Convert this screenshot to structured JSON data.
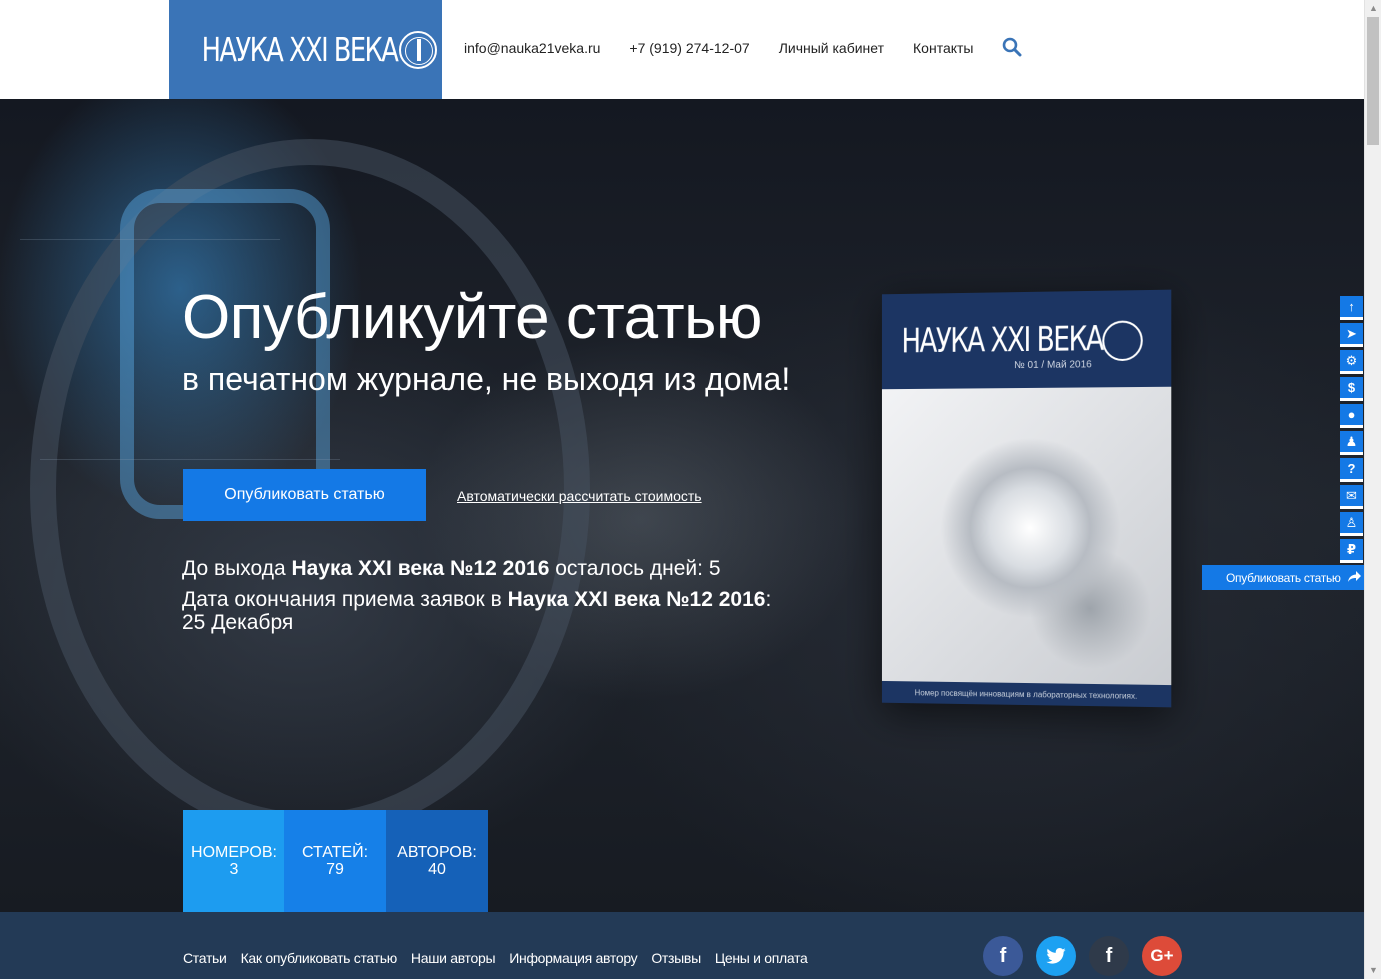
{
  "header": {
    "logo_text": "НАУКА XXI ВЕКА",
    "email": "info@nauka21veka.ru",
    "phone": "+7 (919) 274-12-07",
    "cabinet": "Личный кабинет",
    "contacts": "Контакты",
    "search_icon": "search-icon"
  },
  "hero": {
    "title": "Опубликуйте статью",
    "subtitle": "в печатном журнале, не выходя из дома!",
    "publish_button": "Опубликовать статью",
    "calc_link": "Автоматически рассчитать стоимость",
    "countdown_prefix": "До выхода ",
    "countdown_issue": "Наука XXI века №12 2016",
    "countdown_suffix": " осталось дней: 5",
    "deadline_prefix": "Дата окончания приема заявок в ",
    "deadline_issue": "Наука XXI века №12 2016",
    "deadline_suffix": ":",
    "deadline_date": "25 Декабря"
  },
  "magazine": {
    "title": "НАУКА XXI ВЕКА",
    "issue": "№ 01 / Май 2016",
    "footer": "Номер посвящён инновациям в лабораторных технологиях."
  },
  "stats": [
    {
      "label": "НОМЕРОВ:",
      "value": "3"
    },
    {
      "label": "СТАТЕЙ:",
      "value": "79"
    },
    {
      "label": "АВТОРОВ:",
      "value": "40"
    }
  ],
  "footer": {
    "links": [
      "Статьи",
      "Как опубликовать статью",
      "Наши авторы",
      "Информация автору",
      "Отзывы",
      "Цены и оплата"
    ],
    "social": [
      {
        "icon": "facebook-icon",
        "glyph": "f",
        "color": "#3b5998"
      },
      {
        "icon": "twitter-icon",
        "glyph": "t",
        "color": "#1da1f2"
      },
      {
        "icon": "facebook-icon",
        "glyph": "f",
        "color": "#2f3a4a"
      },
      {
        "icon": "google-plus-icon",
        "glyph": "G+",
        "color": "#dd4b39"
      }
    ]
  },
  "sidebar": {
    "icons": [
      {
        "icon": "arrow-up-icon",
        "glyph": "↑"
      },
      {
        "icon": "send-icon",
        "glyph": "➤"
      },
      {
        "icon": "gear-icon",
        "glyph": "⚙"
      },
      {
        "icon": "dollar-icon",
        "glyph": "$"
      },
      {
        "icon": "comment-icon",
        "glyph": "●"
      },
      {
        "icon": "users-icon",
        "glyph": "♟"
      },
      {
        "icon": "question-icon",
        "glyph": "?"
      },
      {
        "icon": "envelope-icon",
        "glyph": "✉"
      },
      {
        "icon": "user-icon",
        "glyph": "♙"
      },
      {
        "icon": "ruble-icon",
        "glyph": "₽"
      }
    ],
    "publish_label": "Опубликовать статью",
    "share_icon": "share-icon"
  },
  "colors": {
    "brand": "#3a74b7",
    "accent": "#1479e6",
    "footer_bg": "#233a56"
  }
}
